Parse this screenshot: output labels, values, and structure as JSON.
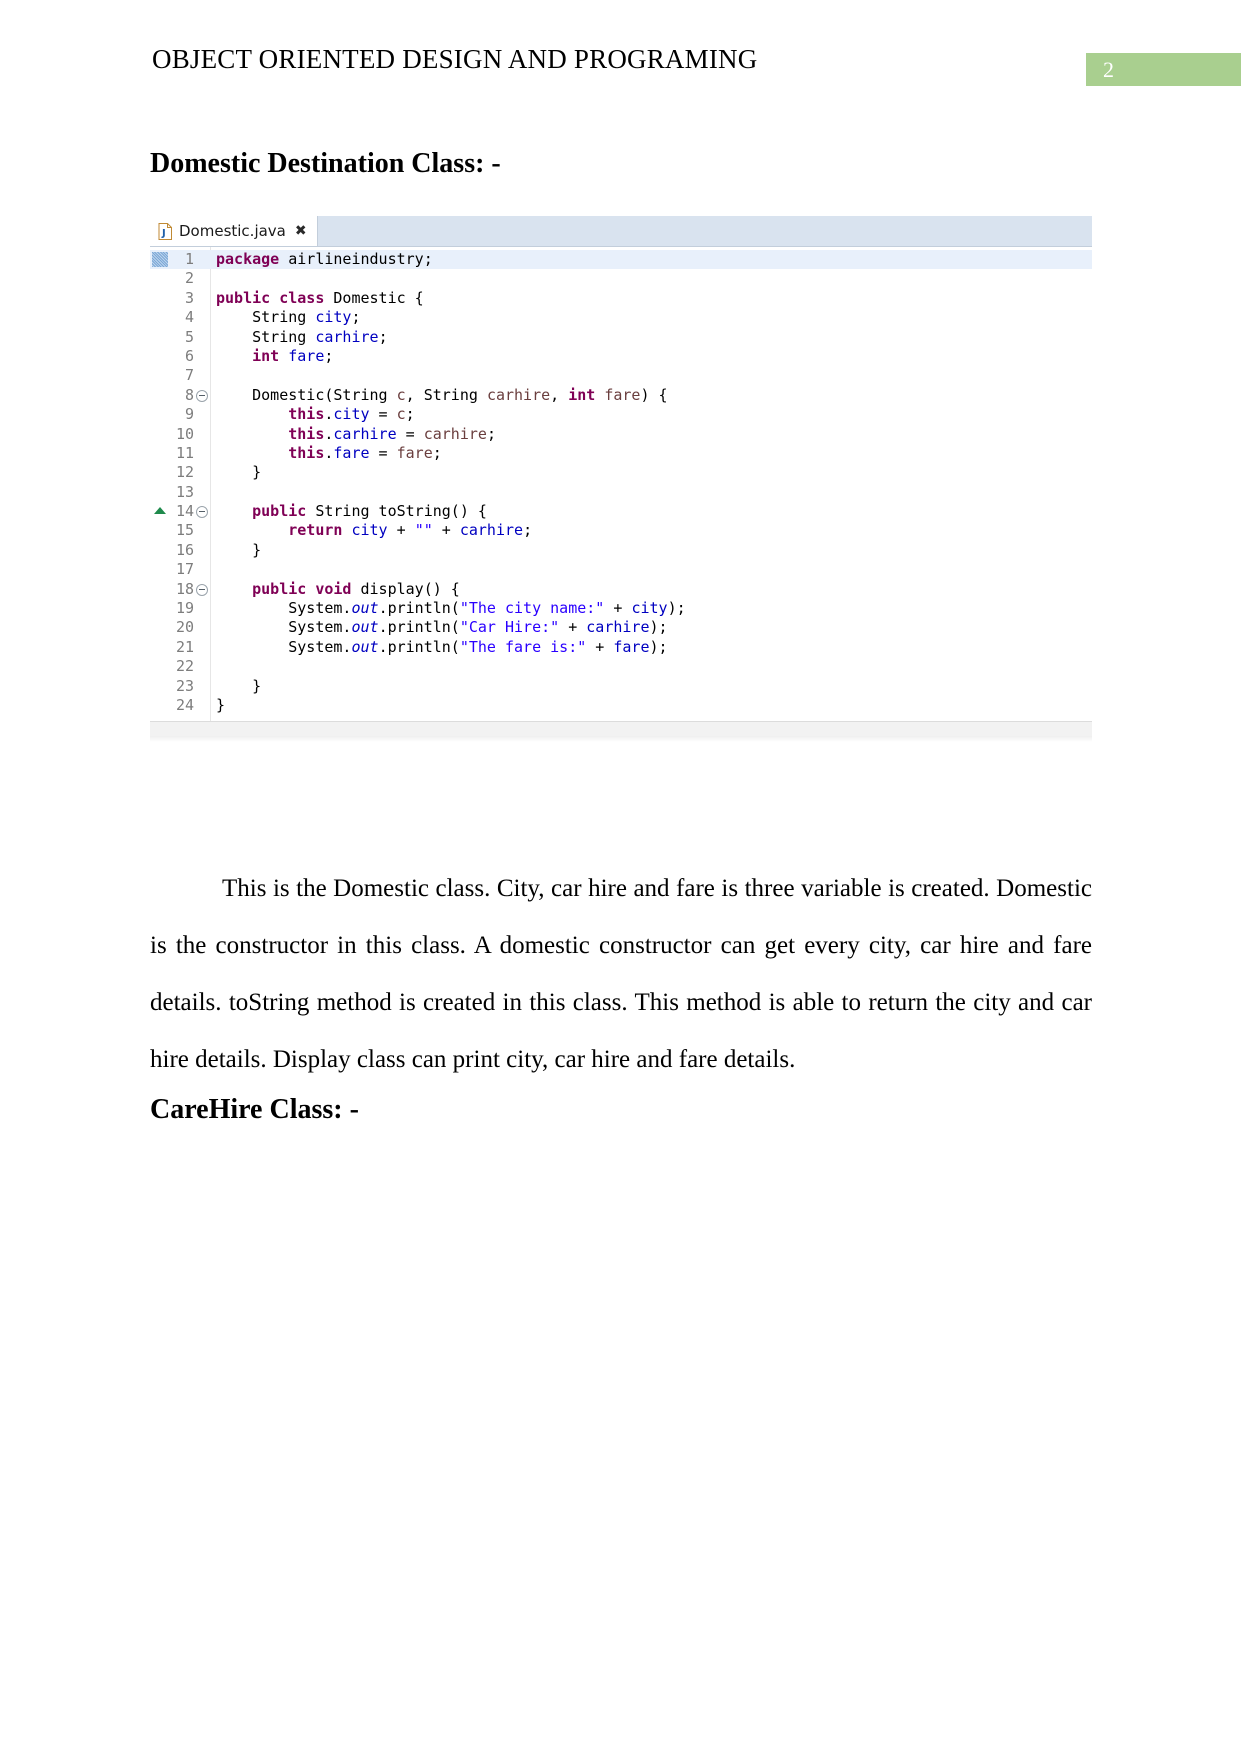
{
  "header": {
    "title": "OBJECT ORIENTED DESIGN AND PROGRAMING",
    "page_number": "2",
    "badge_color": "#a9cf8f"
  },
  "headings": {
    "domestic": "Domestic Destination Class: -",
    "carehire": "CareHire Class: -"
  },
  "editor": {
    "tab_label": "Domestic.java",
    "tab_icon": "java-file-icon",
    "close_icon": "✖",
    "lines": [
      {
        "no": "1",
        "fold": false,
        "marker": "bookmark",
        "overview": false,
        "current": true,
        "tokens": [
          {
            "t": "package",
            "c": "k"
          },
          {
            "t": " airlineindustry;",
            "c": "pln"
          }
        ]
      },
      {
        "no": "2",
        "fold": false,
        "marker": "",
        "overview": false,
        "current": false,
        "tokens": []
      },
      {
        "no": "3",
        "fold": false,
        "marker": "",
        "overview": false,
        "current": false,
        "tokens": [
          {
            "t": "public",
            "c": "k"
          },
          {
            "t": " ",
            "c": "pln"
          },
          {
            "t": "class",
            "c": "k"
          },
          {
            "t": " Domestic {",
            "c": "pln"
          }
        ]
      },
      {
        "no": "4",
        "fold": false,
        "marker": "",
        "overview": false,
        "current": false,
        "tokens": [
          {
            "t": "    String ",
            "c": "pln"
          },
          {
            "t": "city",
            "c": "fld"
          },
          {
            "t": ";",
            "c": "pln"
          }
        ]
      },
      {
        "no": "5",
        "fold": false,
        "marker": "",
        "overview": false,
        "current": false,
        "tokens": [
          {
            "t": "    String ",
            "c": "pln"
          },
          {
            "t": "carhire",
            "c": "fld"
          },
          {
            "t": ";",
            "c": "pln"
          }
        ]
      },
      {
        "no": "6",
        "fold": false,
        "marker": "",
        "overview": false,
        "current": false,
        "tokens": [
          {
            "t": "    ",
            "c": "pln"
          },
          {
            "t": "int",
            "c": "k"
          },
          {
            "t": " ",
            "c": "pln"
          },
          {
            "t": "fare",
            "c": "fld"
          },
          {
            "t": ";",
            "c": "pln"
          }
        ]
      },
      {
        "no": "7",
        "fold": false,
        "marker": "",
        "overview": false,
        "current": false,
        "tokens": []
      },
      {
        "no": "8",
        "fold": true,
        "marker": "",
        "overview": false,
        "current": false,
        "tokens": [
          {
            "t": "    Domestic(String ",
            "c": "pln"
          },
          {
            "t": "c",
            "c": "par"
          },
          {
            "t": ", String ",
            "c": "pln"
          },
          {
            "t": "carhire",
            "c": "par"
          },
          {
            "t": ", ",
            "c": "pln"
          },
          {
            "t": "int",
            "c": "k"
          },
          {
            "t": " ",
            "c": "pln"
          },
          {
            "t": "fare",
            "c": "par"
          },
          {
            "t": ") {",
            "c": "pln"
          }
        ]
      },
      {
        "no": "9",
        "fold": false,
        "marker": "",
        "overview": false,
        "current": false,
        "tokens": [
          {
            "t": "        ",
            "c": "pln"
          },
          {
            "t": "this",
            "c": "k"
          },
          {
            "t": ".",
            "c": "pln"
          },
          {
            "t": "city",
            "c": "fld"
          },
          {
            "t": " = ",
            "c": "pln"
          },
          {
            "t": "c",
            "c": "par"
          },
          {
            "t": ";",
            "c": "pln"
          }
        ]
      },
      {
        "no": "10",
        "fold": false,
        "marker": "",
        "overview": false,
        "current": false,
        "tokens": [
          {
            "t": "        ",
            "c": "pln"
          },
          {
            "t": "this",
            "c": "k"
          },
          {
            "t": ".",
            "c": "pln"
          },
          {
            "t": "carhire",
            "c": "fld"
          },
          {
            "t": " = ",
            "c": "pln"
          },
          {
            "t": "carhire",
            "c": "par"
          },
          {
            "t": ";",
            "c": "pln"
          }
        ]
      },
      {
        "no": "11",
        "fold": false,
        "marker": "",
        "overview": false,
        "current": false,
        "tokens": [
          {
            "t": "        ",
            "c": "pln"
          },
          {
            "t": "this",
            "c": "k"
          },
          {
            "t": ".",
            "c": "pln"
          },
          {
            "t": "fare",
            "c": "fld"
          },
          {
            "t": " = ",
            "c": "pln"
          },
          {
            "t": "fare",
            "c": "par"
          },
          {
            "t": ";",
            "c": "pln"
          }
        ]
      },
      {
        "no": "12",
        "fold": false,
        "marker": "",
        "overview": false,
        "current": false,
        "tokens": [
          {
            "t": "    }",
            "c": "pln"
          }
        ]
      },
      {
        "no": "13",
        "fold": false,
        "marker": "",
        "overview": false,
        "current": false,
        "tokens": []
      },
      {
        "no": "14",
        "fold": true,
        "marker": "",
        "overview": true,
        "current": false,
        "tokens": [
          {
            "t": "    ",
            "c": "pln"
          },
          {
            "t": "public",
            "c": "k"
          },
          {
            "t": " String toString() {",
            "c": "pln"
          }
        ]
      },
      {
        "no": "15",
        "fold": false,
        "marker": "",
        "overview": false,
        "current": false,
        "tokens": [
          {
            "t": "        ",
            "c": "pln"
          },
          {
            "t": "return",
            "c": "k"
          },
          {
            "t": " ",
            "c": "pln"
          },
          {
            "t": "city",
            "c": "fld"
          },
          {
            "t": " + ",
            "c": "pln"
          },
          {
            "t": "\"\"",
            "c": "str"
          },
          {
            "t": " + ",
            "c": "pln"
          },
          {
            "t": "carhire",
            "c": "fld"
          },
          {
            "t": ";",
            "c": "pln"
          }
        ]
      },
      {
        "no": "16",
        "fold": false,
        "marker": "",
        "overview": false,
        "current": false,
        "tokens": [
          {
            "t": "    }",
            "c": "pln"
          }
        ]
      },
      {
        "no": "17",
        "fold": false,
        "marker": "",
        "overview": false,
        "current": false,
        "tokens": []
      },
      {
        "no": "18",
        "fold": true,
        "marker": "",
        "overview": false,
        "current": false,
        "tokens": [
          {
            "t": "    ",
            "c": "pln"
          },
          {
            "t": "public",
            "c": "k"
          },
          {
            "t": " ",
            "c": "pln"
          },
          {
            "t": "void",
            "c": "k"
          },
          {
            "t": " display() {",
            "c": "pln"
          }
        ]
      },
      {
        "no": "19",
        "fold": false,
        "marker": "",
        "overview": false,
        "current": false,
        "tokens": [
          {
            "t": "        System.",
            "c": "pln"
          },
          {
            "t": "out",
            "c": "sfl"
          },
          {
            "t": ".println(",
            "c": "pln"
          },
          {
            "t": "\"The city name:\"",
            "c": "str"
          },
          {
            "t": " + ",
            "c": "pln"
          },
          {
            "t": "city",
            "c": "fld"
          },
          {
            "t": ");",
            "c": "pln"
          }
        ]
      },
      {
        "no": "20",
        "fold": false,
        "marker": "",
        "overview": false,
        "current": false,
        "tokens": [
          {
            "t": "        System.",
            "c": "pln"
          },
          {
            "t": "out",
            "c": "sfl"
          },
          {
            "t": ".println(",
            "c": "pln"
          },
          {
            "t": "\"Car Hire:\"",
            "c": "str"
          },
          {
            "t": " + ",
            "c": "pln"
          },
          {
            "t": "carhire",
            "c": "fld"
          },
          {
            "t": ");",
            "c": "pln"
          }
        ]
      },
      {
        "no": "21",
        "fold": false,
        "marker": "",
        "overview": false,
        "current": false,
        "tokens": [
          {
            "t": "        System.",
            "c": "pln"
          },
          {
            "t": "out",
            "c": "sfl"
          },
          {
            "t": ".println(",
            "c": "pln"
          },
          {
            "t": "\"The fare is:\"",
            "c": "str"
          },
          {
            "t": " + ",
            "c": "pln"
          },
          {
            "t": "fare",
            "c": "fld"
          },
          {
            "t": ");",
            "c": "pln"
          }
        ]
      },
      {
        "no": "22",
        "fold": false,
        "marker": "",
        "overview": false,
        "current": false,
        "tokens": []
      },
      {
        "no": "23",
        "fold": false,
        "marker": "",
        "overview": false,
        "current": false,
        "tokens": [
          {
            "t": "    }",
            "c": "pln"
          }
        ]
      },
      {
        "no": "24",
        "fold": false,
        "marker": "",
        "overview": false,
        "current": false,
        "tokens": [
          {
            "t": "}",
            "c": "pln"
          }
        ]
      }
    ]
  },
  "body": {
    "paragraph": "This is the Domestic class. City, car hire and fare is three variable is created. Domestic is the constructor in this class. A domestic constructor can get every city, car hire and fare details. toString method is created in this class. This method is able to return the city and car hire details. Display class can print city, car hire and fare details."
  }
}
